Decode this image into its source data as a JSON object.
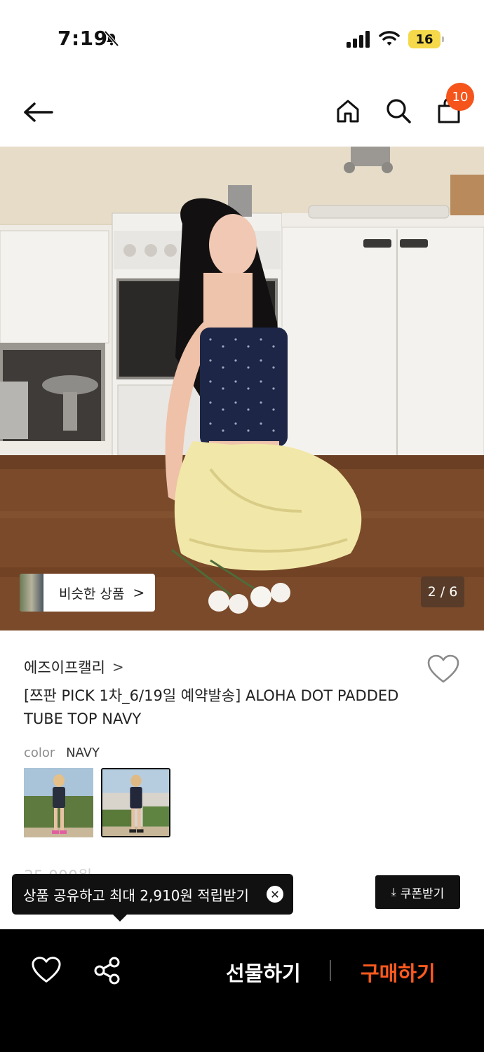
{
  "status_bar": {
    "time": "7:19",
    "battery": "16",
    "icons": [
      "bell-slash-icon",
      "signal-icon",
      "wifi-icon",
      "battery-icon"
    ]
  },
  "header": {
    "icons": [
      "back-arrow-icon",
      "home-icon",
      "search-icon",
      "bag-icon"
    ],
    "cart_count": "10",
    "badge_color": "#f5541b"
  },
  "hero": {
    "similar_label": "비슷한 상품",
    "similar_chevron": ">",
    "page_indicator": "2 / 6"
  },
  "product": {
    "brand": "에즈이프캘리",
    "brand_chevron": ">",
    "title": "[쯔판 PICK 1차_6/19일 예약발송] ALOHA DOT PADDED TUBE TOP NAVY",
    "color_label": "color",
    "color_value": "NAVY",
    "price_peek": "35,000원"
  },
  "share_tooltip": {
    "text": "상품 공유하고 최대 2,910원 적립받기",
    "close": "✕"
  },
  "coupon": {
    "icon": "⤓",
    "label": "쿠폰받기"
  },
  "bottom_bar": {
    "gift_label": "선물하기",
    "buy_label": "구매하기",
    "buy_color": "#ff5a1f"
  }
}
